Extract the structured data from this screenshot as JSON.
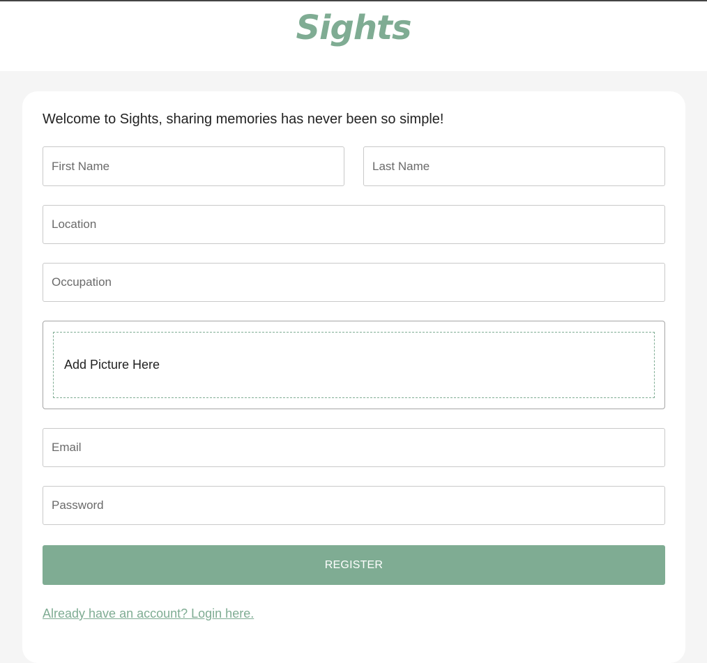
{
  "header": {
    "logo_text": "Sights"
  },
  "form": {
    "welcome_text": "Welcome to Sights, sharing memories has never been so simple!",
    "first_name": {
      "placeholder": "First Name",
      "value": ""
    },
    "last_name": {
      "placeholder": "Last Name",
      "value": ""
    },
    "location": {
      "placeholder": "Location",
      "value": ""
    },
    "occupation": {
      "placeholder": "Occupation",
      "value": ""
    },
    "picture_dropzone_label": "Add Picture Here",
    "email": {
      "placeholder": "Email",
      "value": ""
    },
    "password": {
      "placeholder": "Password",
      "value": ""
    },
    "register_label": "REGISTER",
    "login_link_text": "Already have an account? Login here."
  },
  "colors": {
    "accent": "#7fac93",
    "page_background": "#f5f5f5",
    "card_background": "#ffffff"
  }
}
